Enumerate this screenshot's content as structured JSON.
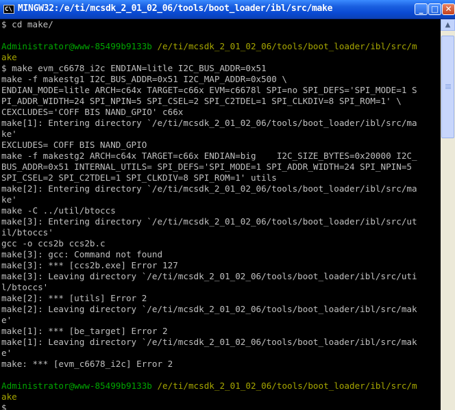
{
  "window": {
    "title": "MINGW32:/e/ti/mcsdk_2_01_02_06/tools/boot_loader/ibl/src/make",
    "icon_text": "C\\"
  },
  "controls": {
    "minimize": "_",
    "maximize": "□",
    "close": "✕"
  },
  "scrollbar": {
    "up_arrow": "▲"
  },
  "colors": {
    "prompt_user": "#00a600",
    "prompt_path": "#a6a600",
    "text": "#c0c0c0",
    "background": "#000000"
  },
  "terminal": {
    "lines": [
      {
        "segments": [
          {
            "t": "$ cd make/",
            "c": ""
          }
        ]
      },
      {
        "segments": [
          {
            "t": "",
            "c": ""
          }
        ]
      },
      {
        "segments": [
          {
            "t": "Administrator@www-85499b9133b",
            "c": "green"
          },
          {
            "t": " /e/ti/mcsdk_2_01_02_06/tools/boot_loader/ibl/src/m",
            "c": "olive"
          }
        ]
      },
      {
        "segments": [
          {
            "t": "ake",
            "c": "olive"
          }
        ]
      },
      {
        "segments": [
          {
            "t": "$ make evm_c6678_i2c ENDIAN=litle I2C_BUS_ADDR=0x51",
            "c": ""
          }
        ]
      },
      {
        "segments": [
          {
            "t": "make -f makestg1 I2C_BUS_ADDR=0x51 I2C_MAP_ADDR=0x500 \\",
            "c": ""
          }
        ]
      },
      {
        "segments": [
          {
            "t": "ENDIAN_MODE=litle ARCH=c64x TARGET=c66x EVM=c6678l SPI=no SPI_DEFS='SPI_MODE=1 S",
            "c": ""
          }
        ]
      },
      {
        "segments": [
          {
            "t": "PI_ADDR_WIDTH=24 SPI_NPIN=5 SPI_CSEL=2 SPI_C2TDEL=1 SPI_CLKDIV=8 SPI_ROM=1' \\",
            "c": ""
          }
        ]
      },
      {
        "segments": [
          {
            "t": "CEXCLUDES='COFF BIS NAND_GPIO' c66x",
            "c": ""
          }
        ]
      },
      {
        "segments": [
          {
            "t": "make[1]: Entering directory `/e/ti/mcsdk_2_01_02_06/tools/boot_loader/ibl/src/ma",
            "c": ""
          }
        ]
      },
      {
        "segments": [
          {
            "t": "ke'",
            "c": ""
          }
        ]
      },
      {
        "segments": [
          {
            "t": "EXCLUDES= COFF BIS NAND_GPIO",
            "c": ""
          }
        ]
      },
      {
        "segments": [
          {
            "t": "make -f makestg2 ARCH=c64x TARGET=c66x ENDIAN=big    I2C_SIZE_BYTES=0x20000 I2C_",
            "c": ""
          }
        ]
      },
      {
        "segments": [
          {
            "t": "BUS_ADDR=0x51 INTERNAL_UTILS= SPI_DEFS='SPI_MODE=1 SPI_ADDR_WIDTH=24 SPI_NPIN=5",
            "c": ""
          }
        ]
      },
      {
        "segments": [
          {
            "t": "SPI_CSEL=2 SPI_C2TDEL=1 SPI_CLKDIV=8 SPI_ROM=1' utils",
            "c": ""
          }
        ]
      },
      {
        "segments": [
          {
            "t": "make[2]: Entering directory `/e/ti/mcsdk_2_01_02_06/tools/boot_loader/ibl/src/ma",
            "c": ""
          }
        ]
      },
      {
        "segments": [
          {
            "t": "ke'",
            "c": ""
          }
        ]
      },
      {
        "segments": [
          {
            "t": "make -C ../util/btoccs",
            "c": ""
          }
        ]
      },
      {
        "segments": [
          {
            "t": "make[3]: Entering directory `/e/ti/mcsdk_2_01_02_06/tools/boot_loader/ibl/src/ut",
            "c": ""
          }
        ]
      },
      {
        "segments": [
          {
            "t": "il/btoccs'",
            "c": ""
          }
        ]
      },
      {
        "segments": [
          {
            "t": "gcc -o ccs2b ccs2b.c",
            "c": ""
          }
        ]
      },
      {
        "segments": [
          {
            "t": "make[3]: gcc: Command not found",
            "c": ""
          }
        ]
      },
      {
        "segments": [
          {
            "t": "make[3]: *** [ccs2b.exe] Error 127",
            "c": ""
          }
        ]
      },
      {
        "segments": [
          {
            "t": "make[3]: Leaving directory `/e/ti/mcsdk_2_01_02_06/tools/boot_loader/ibl/src/uti",
            "c": ""
          }
        ]
      },
      {
        "segments": [
          {
            "t": "l/btoccs'",
            "c": ""
          }
        ]
      },
      {
        "segments": [
          {
            "t": "make[2]: *** [utils] Error 2",
            "c": ""
          }
        ]
      },
      {
        "segments": [
          {
            "t": "make[2]: Leaving directory `/e/ti/mcsdk_2_01_02_06/tools/boot_loader/ibl/src/mak",
            "c": ""
          }
        ]
      },
      {
        "segments": [
          {
            "t": "e'",
            "c": ""
          }
        ]
      },
      {
        "segments": [
          {
            "t": "make[1]: *** [be_target] Error 2",
            "c": ""
          }
        ]
      },
      {
        "segments": [
          {
            "t": "make[1]: Leaving directory `/e/ti/mcsdk_2_01_02_06/tools/boot_loader/ibl/src/mak",
            "c": ""
          }
        ]
      },
      {
        "segments": [
          {
            "t": "e'",
            "c": ""
          }
        ]
      },
      {
        "segments": [
          {
            "t": "make: *** [evm_c6678_i2c] Error 2",
            "c": ""
          }
        ]
      },
      {
        "segments": [
          {
            "t": "",
            "c": ""
          }
        ]
      },
      {
        "segments": [
          {
            "t": "Administrator@www-85499b9133b",
            "c": "green"
          },
          {
            "t": " /e/ti/mcsdk_2_01_02_06/tools/boot_loader/ibl/src/m",
            "c": "olive"
          }
        ]
      },
      {
        "segments": [
          {
            "t": "ake",
            "c": "olive"
          }
        ]
      },
      {
        "segments": [
          {
            "t": "$",
            "c": ""
          }
        ]
      }
    ]
  }
}
